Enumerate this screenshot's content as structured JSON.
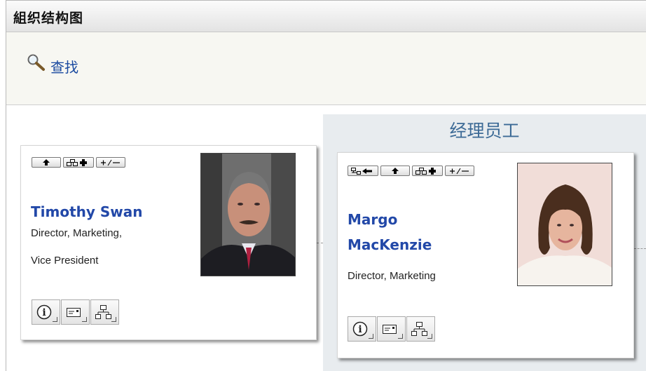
{
  "page": {
    "title": "組织结构图"
  },
  "search": {
    "label": "查找"
  },
  "manager_panel": {
    "title": "经理员工"
  },
  "cards": [
    {
      "name": "Timothy Swan",
      "title_lines": [
        "Director, Marketing,",
        "Vice President"
      ]
    },
    {
      "name_lines": [
        "Margo",
        "MacKenzie"
      ],
      "title_lines": [
        "Director, Marketing"
      ]
    }
  ],
  "icons": {
    "search": "magnifier-icon",
    "up": "arrow-up-icon",
    "expand": "org-expand-icon",
    "toggle": "plus-minus-icon",
    "restore": "restore-left-icon",
    "info": "info-icon",
    "email": "email-card-icon",
    "org": "org-chart-icon"
  },
  "colors": {
    "link": "#1a4aa0",
    "name": "#2248a8",
    "panel": "#e8ecef",
    "panel_title": "#3c6a96"
  }
}
